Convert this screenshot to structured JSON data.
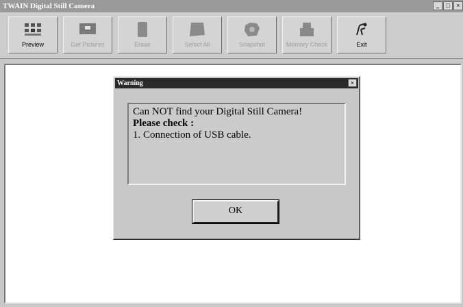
{
  "window": {
    "title": "TWAIN  Digital Still Camera",
    "controls": [
      "_",
      "□",
      "×"
    ]
  },
  "toolbar": {
    "buttons": [
      {
        "label": "Preview",
        "icon": "preview-icon",
        "enabled": true
      },
      {
        "label": "Get Pictures",
        "icon": "get-pictures-icon",
        "enabled": false
      },
      {
        "label": "Erase",
        "icon": "erase-icon",
        "enabled": false
      },
      {
        "label": "Select All",
        "icon": "select-all-icon",
        "enabled": false
      },
      {
        "label": "Snapshot",
        "icon": "snapshot-icon",
        "enabled": false
      },
      {
        "label": "Memory Check",
        "icon": "memory-check-icon",
        "enabled": false
      },
      {
        "label": "Exit",
        "icon": "exit-icon",
        "enabled": true
      }
    ]
  },
  "dialog": {
    "title": "Warning",
    "close": "×",
    "message": {
      "line1": "Can NOT find your Digital Still Camera!",
      "line2": "Please check :",
      "line3": "1. Connection of USB cable."
    },
    "ok_label": "OK"
  }
}
